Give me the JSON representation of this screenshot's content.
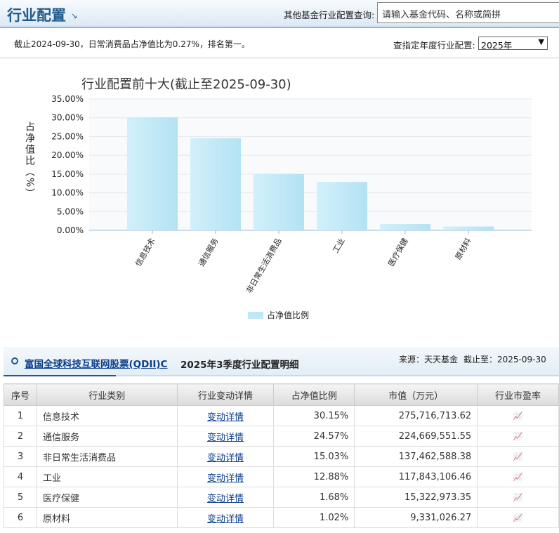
{
  "header": {
    "title": "行业配置",
    "query_label": "其他基金行业配置查询:",
    "query_placeholder": "请输入基金代码、名称或简拼"
  },
  "note": "截止2024-09-30，日常消费品占净值比为0.27%，排名第一。",
  "year_select": {
    "label": "查指定年度行业配置:",
    "value": "2025年"
  },
  "chart_data": {
    "type": "bar",
    "title": "行业配置前十大(截止至2025-09-30)",
    "ylabel": "占净值比（%）",
    "ylim": [
      0,
      35
    ],
    "yticks": [
      "0.00%",
      "5.00%",
      "10.00%",
      "15.00%",
      "20.00%",
      "25.00%",
      "30.00%",
      "35.00%"
    ],
    "categories": [
      "信息技术",
      "通信服务",
      "非日常生活消费品",
      "工业",
      "医疗保健",
      "原材料"
    ],
    "series": [
      {
        "name": "占净值比例",
        "values": [
          30.15,
          24.57,
          15.03,
          12.88,
          1.68,
          1.02
        ]
      }
    ],
    "legend": "bottom",
    "grid": true
  },
  "section": {
    "fund_name": "富国全球科技互联网股票(QDII)C",
    "subtitle": "2025年3季度行业配置明细",
    "source": "来源：天天基金",
    "date": "截止至：2025-09-30"
  },
  "table": {
    "headers": [
      "序号",
      "行业类别",
      "行业变动详情",
      "占净值比例",
      "市值（万元）",
      "行业市盈率"
    ],
    "rows": [
      {
        "no": "1",
        "name": "信息技术",
        "link": "变动详情",
        "ratio": "30.15%",
        "value": "275,716,713.62"
      },
      {
        "no": "2",
        "name": "通信服务",
        "link": "变动详情",
        "ratio": "24.57%",
        "value": "224,669,551.55"
      },
      {
        "no": "3",
        "name": "非日常生活消费品",
        "link": "变动详情",
        "ratio": "15.03%",
        "value": "137,462,588.38"
      },
      {
        "no": "4",
        "name": "工业",
        "link": "变动详情",
        "ratio": "12.88%",
        "value": "117,843,106.46"
      },
      {
        "no": "5",
        "name": "医疗保健",
        "link": "变动详情",
        "ratio": "1.68%",
        "value": "15,322,973.35"
      },
      {
        "no": "6",
        "name": "原材料",
        "link": "变动详情",
        "ratio": "1.02%",
        "value": "9,331,026.27"
      }
    ]
  },
  "colors": {
    "bar": "#bfe8f6",
    "accent": "#1f5a8c"
  }
}
